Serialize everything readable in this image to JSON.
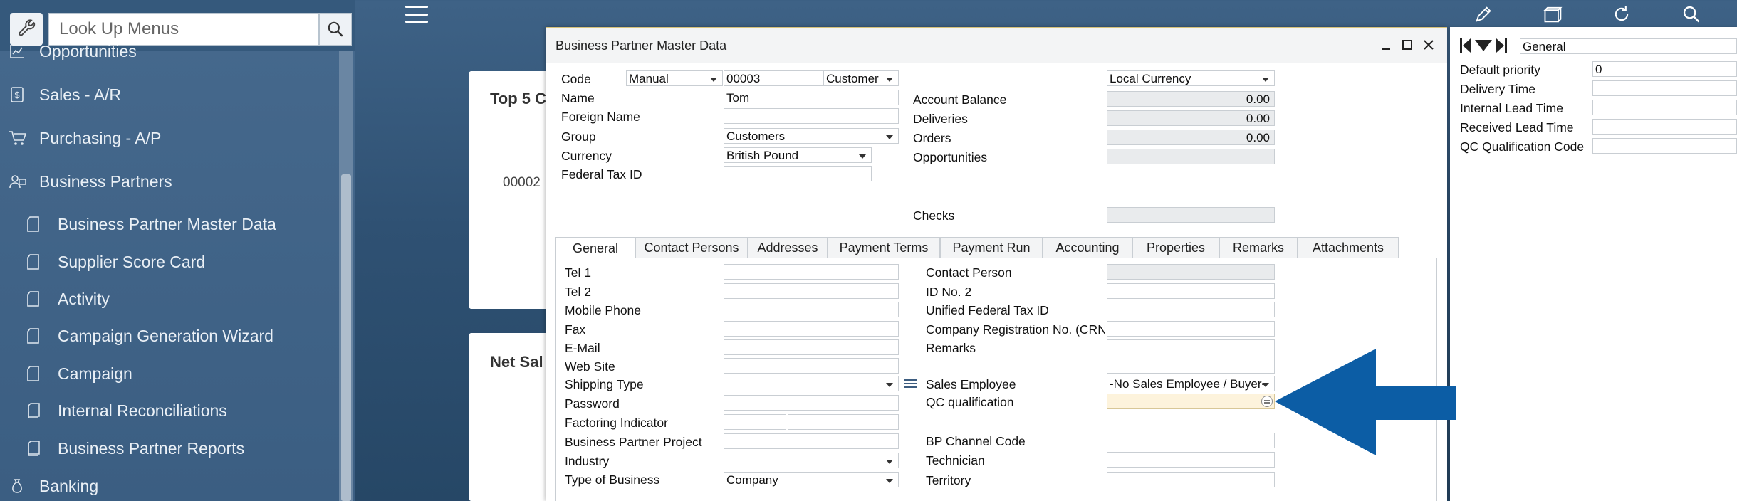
{
  "sidebar": {
    "search_placeholder": "Look Up Menus",
    "items": [
      {
        "label": "Opportunities",
        "icon": "chart-icon",
        "level": 1
      },
      {
        "label": "Sales - A/R",
        "icon": "dollar-icon",
        "level": 1
      },
      {
        "label": "Purchasing - A/P",
        "icon": "cart-icon",
        "level": 1
      },
      {
        "label": "Business Partners",
        "icon": "people-icon",
        "level": 1
      },
      {
        "label": "Business Partner Master Data",
        "icon": "document-icon",
        "level": 2
      },
      {
        "label": "Supplier Score Card",
        "icon": "document-icon",
        "level": 2
      },
      {
        "label": "Activity",
        "icon": "document-icon",
        "level": 2
      },
      {
        "label": "Campaign Generation Wizard",
        "icon": "document-icon",
        "level": 2
      },
      {
        "label": "Campaign",
        "icon": "document-icon",
        "level": 2
      },
      {
        "label": "Internal Reconciliations",
        "icon": "folder-icon",
        "level": 2
      },
      {
        "label": "Business Partner Reports",
        "icon": "folder-icon",
        "level": 2
      },
      {
        "label": "Banking",
        "icon": "moneybag-icon",
        "level": 1
      }
    ]
  },
  "dashboard": {
    "card1_title": "Top 5 C",
    "card1_value": "00002",
    "card2_title": "Net Sal"
  },
  "toolbar": {
    "icons": [
      "pencil-icon",
      "folder-icon",
      "refresh-icon",
      "search-icon"
    ]
  },
  "bp_window": {
    "title": "Business Partner Master Data",
    "header": {
      "code_label": "Code",
      "code_series": "Manual",
      "code_value": "00003",
      "code_type": "Customer",
      "name_label": "Name",
      "name_value": "Tom",
      "foreign_name_label": "Foreign Name",
      "foreign_name_value": "",
      "group_label": "Group",
      "group_value": "Customers",
      "currency_label": "Currency",
      "currency_value": "British Pound",
      "federal_tax_label": "Federal Tax ID",
      "federal_tax_value": "",
      "local_currency": "Local Currency",
      "account_balance_label": "Account Balance",
      "account_balance_value": "0.00",
      "deliveries_label": "Deliveries",
      "deliveries_value": "0.00",
      "orders_label": "Orders",
      "orders_value": "0.00",
      "opportunities_label": "Opportunities",
      "checks_label": "Checks"
    },
    "tabs": [
      {
        "label": "General",
        "active": true
      },
      {
        "label": "Contact Persons"
      },
      {
        "label": "Addresses"
      },
      {
        "label": "Payment Terms"
      },
      {
        "label": "Payment Run"
      },
      {
        "label": "Accounting"
      },
      {
        "label": "Properties"
      },
      {
        "label": "Remarks"
      },
      {
        "label": "Attachments"
      }
    ],
    "general": {
      "tel1_label": "Tel 1",
      "tel2_label": "Tel 2",
      "mobile_label": "Mobile Phone",
      "fax_label": "Fax",
      "email_label": "E-Mail",
      "website_label": "Web Site",
      "shipping_label": "Shipping Type",
      "password_label": "Password",
      "factoring_label": "Factoring Indicator",
      "bp_project_label": "Business Partner Project",
      "industry_label": "Industry",
      "type_business_label": "Type of Business",
      "type_business_value": "Company",
      "contact_person_label": "Contact Person",
      "id_no2_label": "ID No. 2",
      "unified_tax_label": "Unified Federal Tax ID",
      "company_reg_label": "Company Registration No. (CRN",
      "remarks_label": "Remarks",
      "sales_employee_label": "Sales Employee",
      "sales_employee_value": "-No Sales Employee / Buyer-",
      "qc_label": "QC qualification",
      "bp_channel_label": "BP Channel Code",
      "technician_label": "Technician",
      "territory_label": "Territory"
    }
  },
  "right_panel": {
    "title": "General",
    "default_priority_label": "Default priority",
    "default_priority_value": "0",
    "delivery_time_label": "Delivery Time",
    "internal_lead_label": "Internal Lead Time",
    "received_lead_label": "Received Lead Time",
    "qc_code_label": "QC Qualification Code"
  },
  "colors": {
    "arrow": "#0c5da5",
    "background": "#2f5173",
    "sidebar": "#42658a"
  }
}
